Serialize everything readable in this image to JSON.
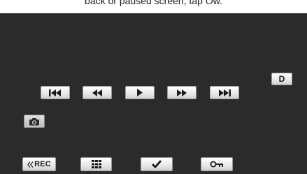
{
  "caption": "back or paused screen, tap Ow.",
  "controls": {
    "skip_back": {
      "icon": "skip-back-icon"
    },
    "rewind": {
      "icon": "rewind-icon"
    },
    "play": {
      "icon": "play-icon"
    },
    "fast_forward": {
      "icon": "fast-forward-icon"
    },
    "skip_forward": {
      "icon": "skip-forward-icon"
    },
    "d_label": "D",
    "camera": {
      "icon": "camera-icon"
    },
    "rec_label": "REC",
    "rec_icon": "double-chevron-left-icon",
    "index": {
      "icon": "index-grid-icon"
    },
    "check": {
      "icon": "checkmark-icon"
    },
    "protect": {
      "icon": "key-protect-icon"
    }
  }
}
